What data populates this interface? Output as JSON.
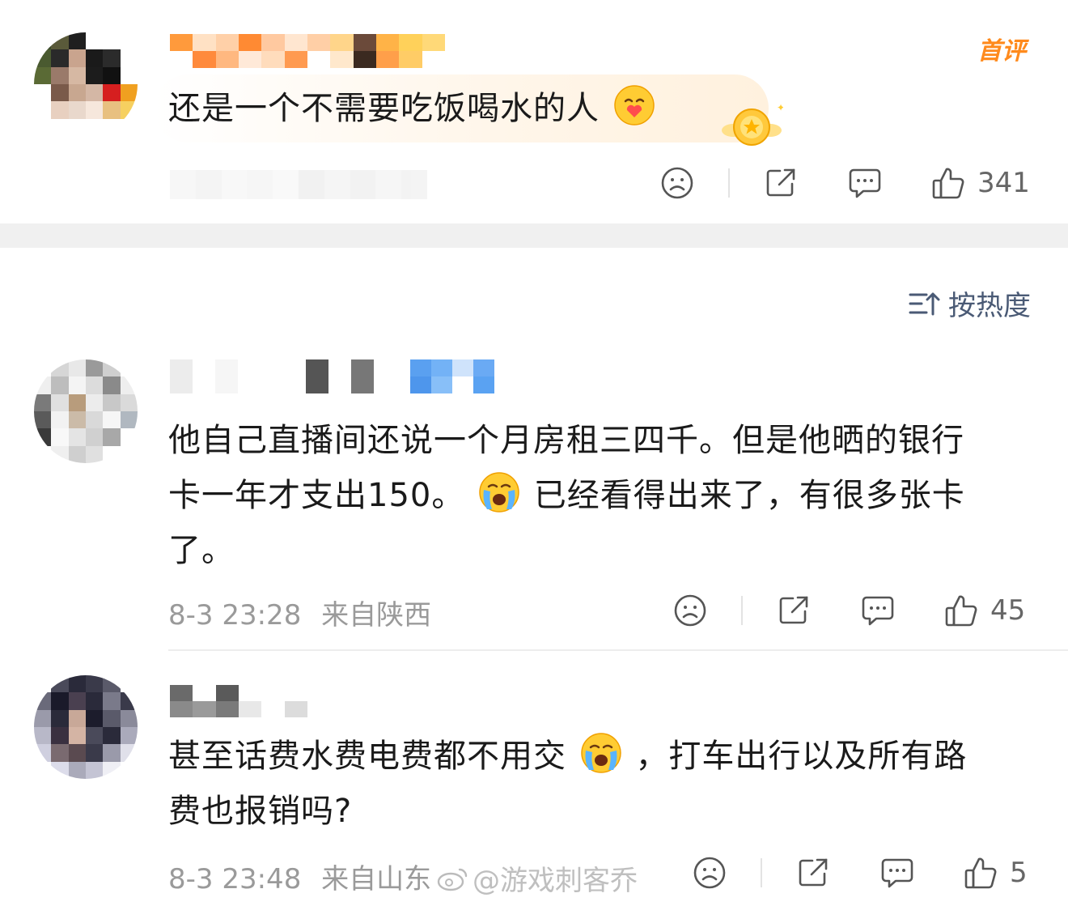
{
  "top_comment": {
    "badge": "首评",
    "text": "还是一个不需要吃饭喝水的人",
    "likes": "341"
  },
  "sort": {
    "label": "按热度"
  },
  "comments": [
    {
      "text_line1": "他自己直播间还说一个月房租三四千。但是他晒的银行",
      "text_line2a": "卡一年才支出150。",
      "text_line2b": "已经看得出来了，有很多张卡",
      "text_line3": "了。",
      "time": "8-3 23:28",
      "location": "来自陕西",
      "likes": "45"
    },
    {
      "text_line1a": "甚至话费水费电费都不用交",
      "text_line1b": "，打车出行以及所有路",
      "text_line2": "费也报销吗?",
      "time": "8-3 23:48",
      "location": "来自山东",
      "likes": "5"
    }
  ],
  "watermark": "@游戏刺客乔",
  "colors": {
    "accent": "#ff8a1c",
    "icon": "#555555",
    "meta": "#9a9a9a",
    "sort": "#4a5a75"
  }
}
